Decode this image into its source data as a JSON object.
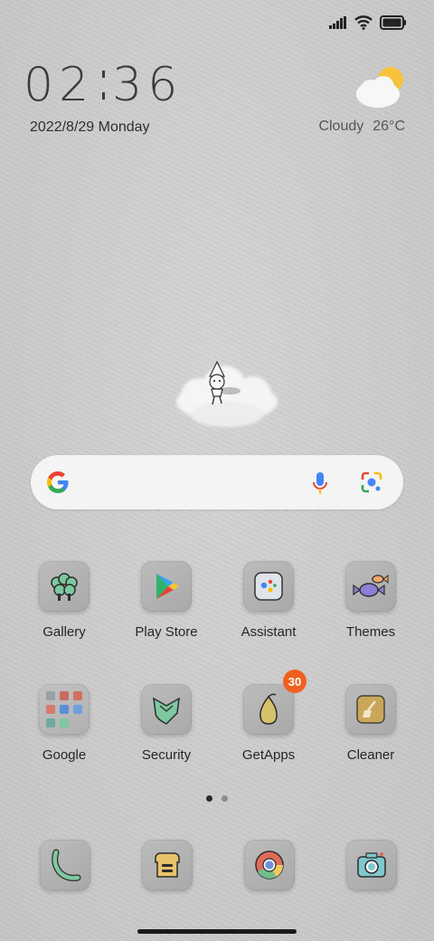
{
  "status_bar": {
    "icons": [
      "signal-icon",
      "wifi-icon",
      "battery-icon"
    ]
  },
  "clock": {
    "hours": "02",
    "minutes": "36"
  },
  "date": "2022/8/29 Monday",
  "weather": {
    "icon": "partly-cloudy-icon",
    "condition": "Cloudy",
    "temperature": "26°C"
  },
  "search": {
    "icons": [
      "google-logo-icon",
      "mic-icon",
      "lens-icon"
    ]
  },
  "apps": [
    {
      "label": "Gallery",
      "icon": "gallery-icon"
    },
    {
      "label": "Play Store",
      "icon": "play-store-icon"
    },
    {
      "label": "Assistant",
      "icon": "assistant-icon"
    },
    {
      "label": "Themes",
      "icon": "themes-icon"
    },
    {
      "label": "Google",
      "icon": "google-folder-icon"
    },
    {
      "label": "Security",
      "icon": "security-icon"
    },
    {
      "label": "GetApps",
      "icon": "getapps-icon",
      "badge": "30"
    },
    {
      "label": "Cleaner",
      "icon": "cleaner-icon"
    }
  ],
  "pager": {
    "pages": 2,
    "current": 1
  },
  "dock": [
    {
      "icon": "phone-icon"
    },
    {
      "icon": "messages-icon"
    },
    {
      "icon": "chrome-icon"
    },
    {
      "icon": "camera-icon"
    }
  ],
  "colors": {
    "badge": "#f06020",
    "wallpaper": "#c9c9c9",
    "accent_green": "#7cc8a0"
  }
}
